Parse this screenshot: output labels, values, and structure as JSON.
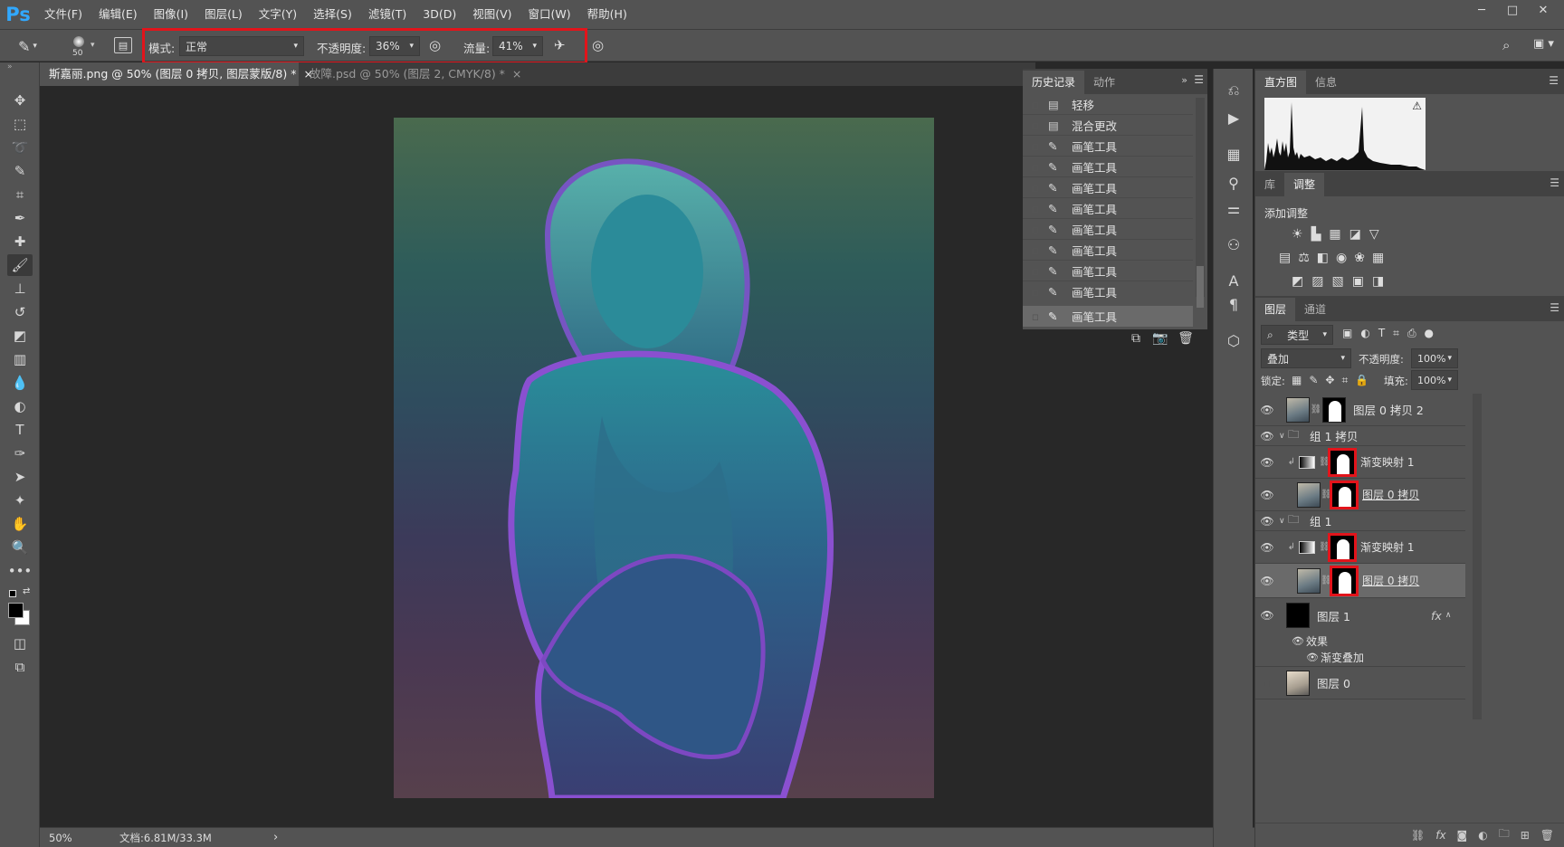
{
  "app": {
    "logo": "Ps"
  },
  "menu": [
    "文件(F)",
    "编辑(E)",
    "图像(I)",
    "图层(L)",
    "文字(Y)",
    "选择(S)",
    "滤镜(T)",
    "3D(D)",
    "视图(V)",
    "窗口(W)",
    "帮助(H)"
  ],
  "options": {
    "brush_size": "50",
    "mode_label": "模式:",
    "mode_value": "正常",
    "opacity_label": "不透明度:",
    "opacity_value": "36%",
    "flow_label": "流量:",
    "flow_value": "41%"
  },
  "tabs": [
    {
      "label": "斯嘉丽.png @ 50% (图层 0 拷贝, 图层蒙版/8) *",
      "close": "×"
    },
    {
      "label": "故障.psd @ 50% (图层 2, CMYK/8) *",
      "close": "×"
    }
  ],
  "status": {
    "zoom": "50%",
    "doc": "文档:6.81M/33.3M",
    "arrow": "›"
  },
  "history": {
    "tabs": [
      "历史记录",
      "动作"
    ],
    "rows": [
      "轻移",
      "混合更改",
      "画笔工具",
      "画笔工具",
      "画笔工具",
      "画笔工具",
      "画笔工具",
      "画笔工具",
      "画笔工具",
      "画笔工具",
      "画笔工具"
    ]
  },
  "histogram": {
    "tabs": [
      "直方图",
      "信息"
    ]
  },
  "adjust": {
    "tabs": [
      "库",
      "调整"
    ],
    "title": "添加调整"
  },
  "layers": {
    "tabs": [
      "图层",
      "通道"
    ],
    "filter_label": "类型",
    "blend_mode": "叠加",
    "opacity_label": "不透明度:",
    "opacity_value": "100%",
    "lock_label": "锁定:",
    "fill_label": "填充:",
    "fill_value": "100%",
    "rows": {
      "r1": "图层 0 拷贝 2",
      "r2": "组 1 拷贝",
      "r3": "渐变映射 1",
      "r4": "图层 0 拷贝",
      "r5": "组 1",
      "r6": "渐变映射 1",
      "r7": "图层 0 拷贝",
      "r8": "图层 1",
      "r8fx": "fx",
      "r9": "效果",
      "r10": "渐变叠加",
      "r11": "图层 0"
    }
  },
  "colors": {
    "accent": "#31a8ff",
    "highlight": "#e2141b",
    "panel": "#535353"
  }
}
